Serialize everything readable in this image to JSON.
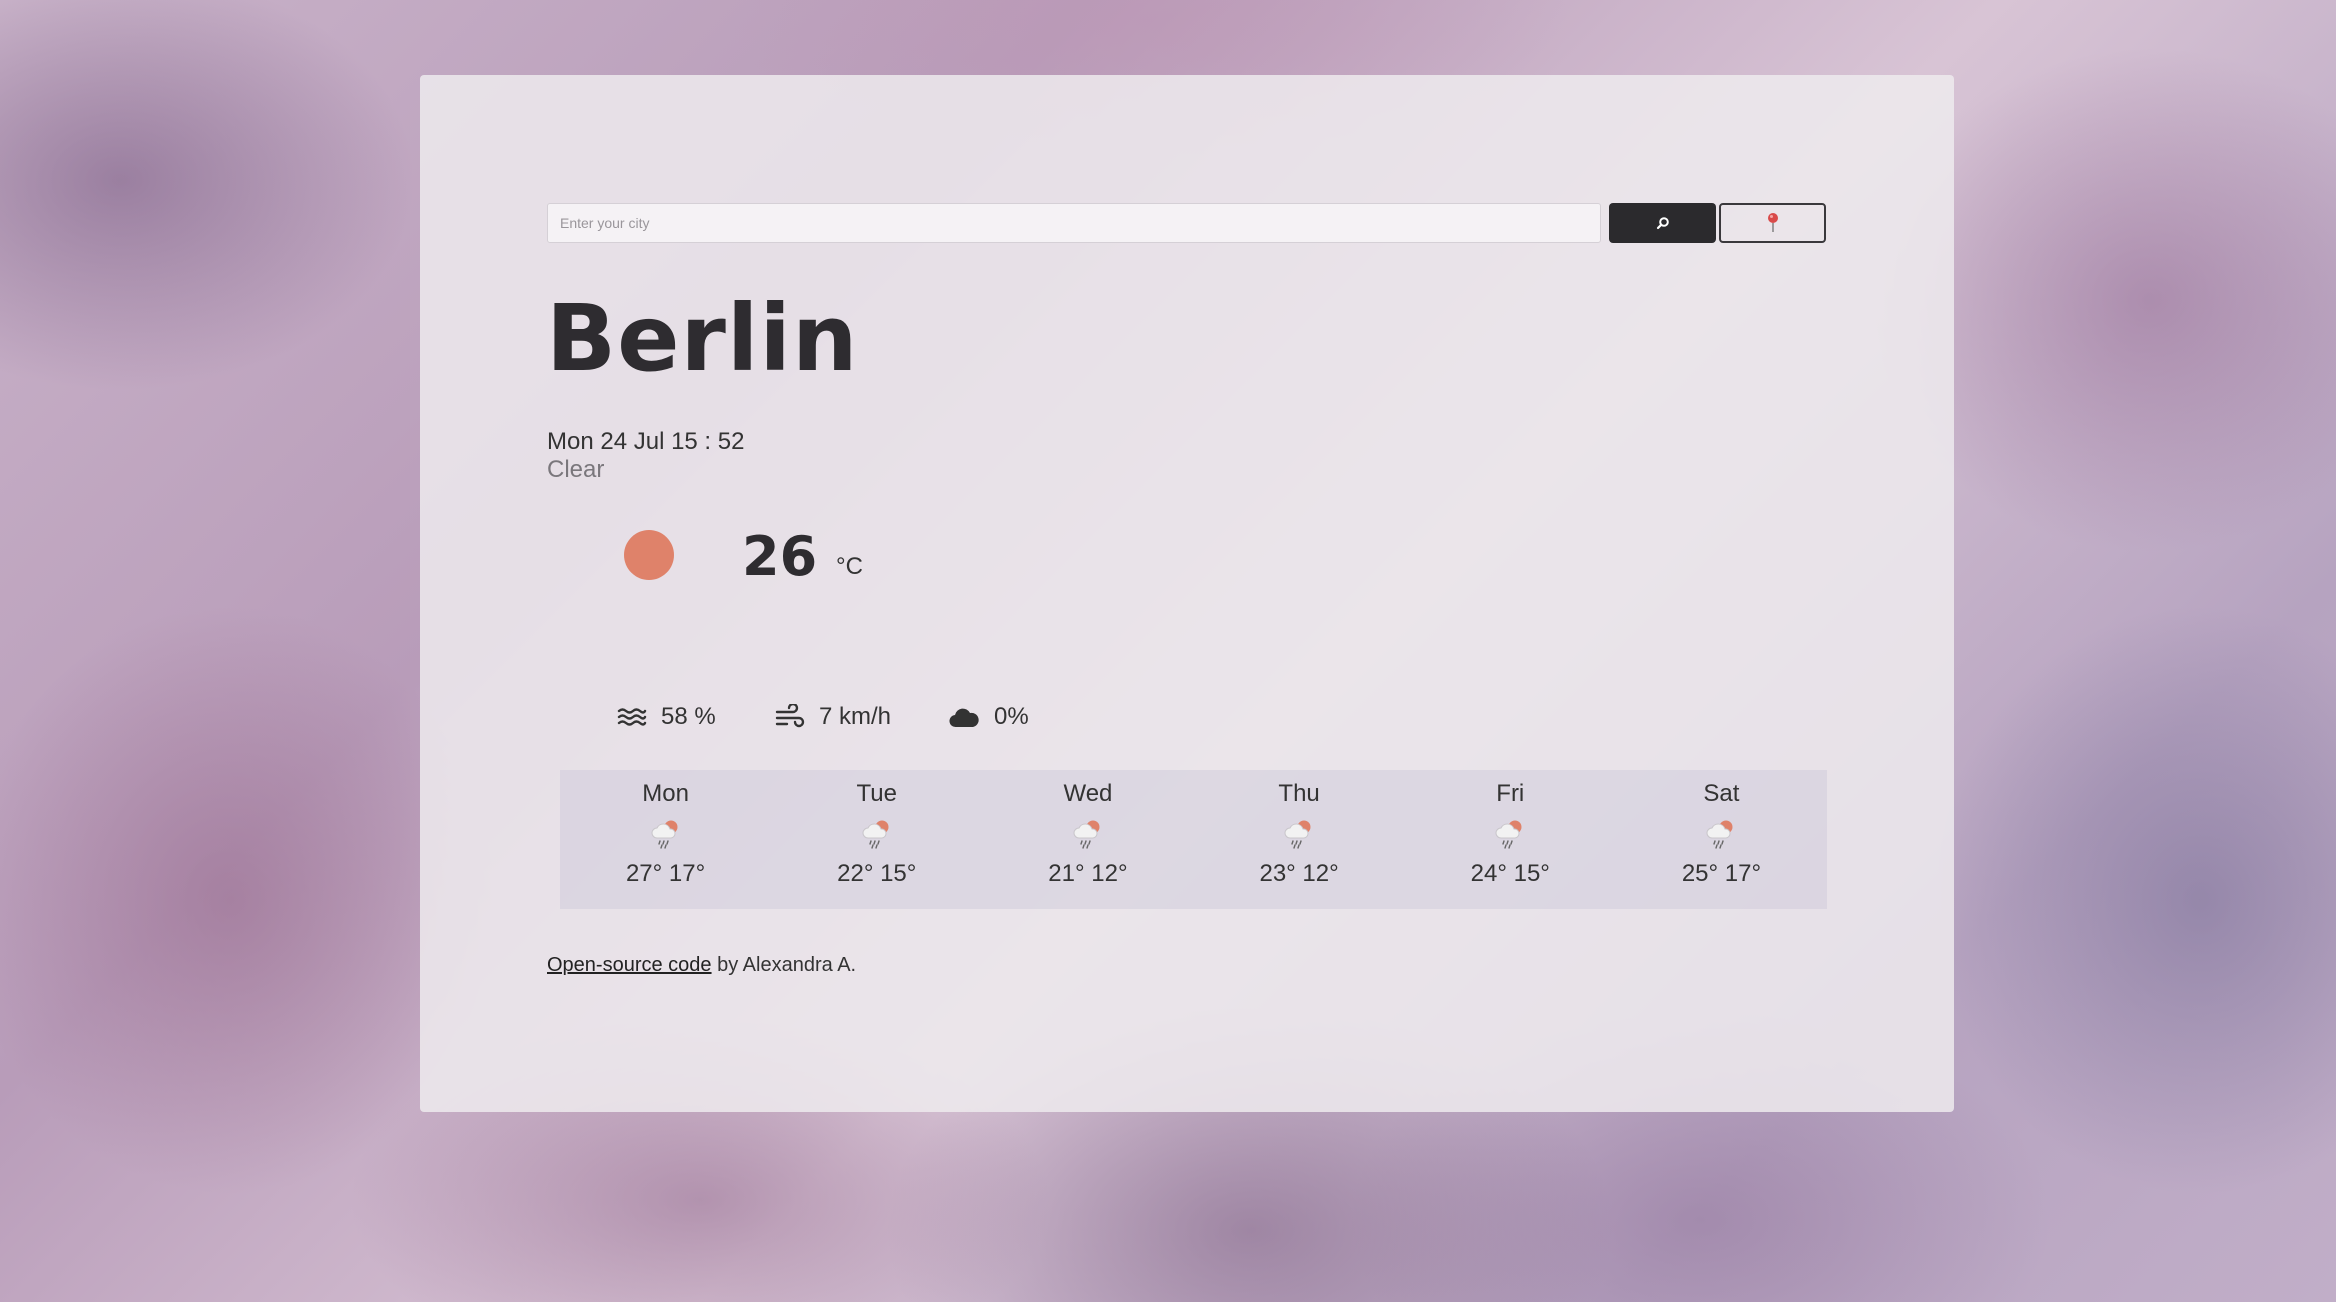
{
  "search": {
    "placeholder": "Enter your city",
    "value": ""
  },
  "buttons": {
    "search_icon": "search-icon",
    "location_icon": "location-pin-icon"
  },
  "current": {
    "city": "Berlin",
    "datetime": "Mon 24 Jul 15 : 52",
    "description": "Clear",
    "icon": "sun-icon",
    "temperature": "26",
    "unit": "°C",
    "humidity": "58 %",
    "wind": "7 km/h",
    "clouds": "0%"
  },
  "forecast": [
    {
      "day": "Mon",
      "temps": "27° 17°",
      "icon": "rain-sun-icon"
    },
    {
      "day": "Tue",
      "temps": "22° 15°",
      "icon": "rain-sun-icon"
    },
    {
      "day": "Wed",
      "temps": "21° 12°",
      "icon": "rain-sun-icon"
    },
    {
      "day": "Thu",
      "temps": "23° 12°",
      "icon": "rain-sun-icon"
    },
    {
      "day": "Fri",
      "temps": "24° 15°",
      "icon": "rain-sun-icon"
    },
    {
      "day": "Sat",
      "temps": "25° 17°",
      "icon": "rain-sun-icon"
    }
  ],
  "footer": {
    "link_text": "Open-source code",
    "rest_text": " by Alexandra A."
  },
  "colors": {
    "sun": "#df826a",
    "button_dark": "#2b2a2d",
    "pin": "#d94a4a"
  }
}
